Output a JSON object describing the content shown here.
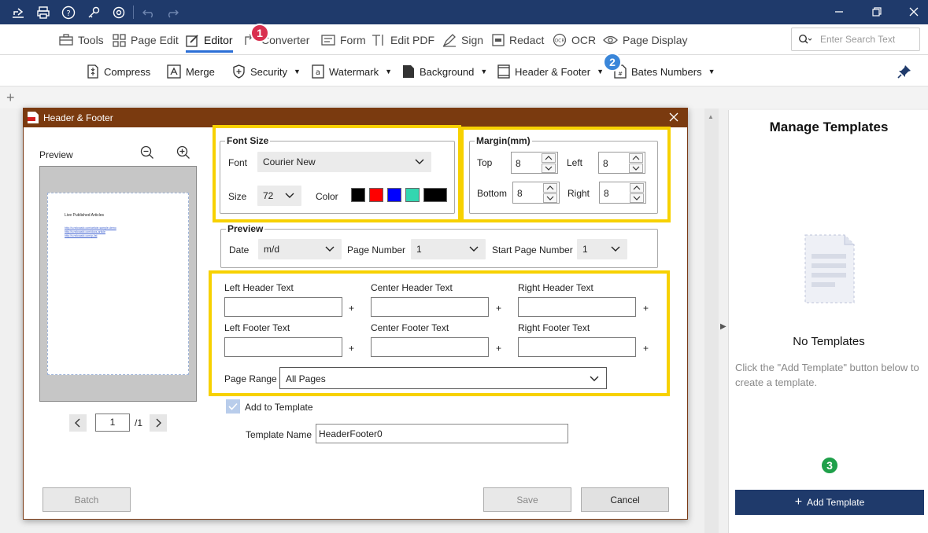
{
  "main_nav": [
    {
      "label": "Tools"
    },
    {
      "label": "Page Edit"
    },
    {
      "label": "Editor"
    },
    {
      "label": "Converter"
    },
    {
      "label": "Form"
    },
    {
      "label": "Edit PDF"
    },
    {
      "label": "Sign"
    },
    {
      "label": "Redact"
    },
    {
      "label": "OCR"
    },
    {
      "label": "Page Display"
    }
  ],
  "search": {
    "placeholder": "Enter Search Text"
  },
  "sub_toolbar": [
    {
      "label": "Compress"
    },
    {
      "label": "Merge"
    },
    {
      "label": "Security"
    },
    {
      "label": "Watermark"
    },
    {
      "label": "Background"
    },
    {
      "label": "Header & Footer"
    },
    {
      "label": "Bates Numbers"
    }
  ],
  "badges": {
    "b1": "1",
    "b2": "2",
    "b3": "3"
  },
  "dialog": {
    "title": "Header & Footer",
    "preview_label": "Preview",
    "thumb": {
      "heading": "Live Published Articles",
      "links": [
        "http://s.nnkxasfo.com/article-sample-demo",
        "http://s.nnkxasfo.com/docs-article",
        "http://s.nnkxasfo.com/p-list"
      ]
    },
    "page_input": "1",
    "page_total": "/1",
    "font_size": {
      "title": "Font Size",
      "font_label": "Font",
      "font_value": "Courier New",
      "size_label": "Size",
      "size_value": "72",
      "color_label": "Color",
      "colors": [
        "#000000",
        "#ff0000",
        "#0000ff",
        "#33d6b0",
        "#000000"
      ]
    },
    "margin": {
      "title": "Margin(mm)",
      "top_label": "Top",
      "top_value": "8",
      "left_label": "Left",
      "left_value": "8",
      "bottom_label": "Bottom",
      "bottom_value": "8",
      "right_label": "Right",
      "right_value": "8"
    },
    "preview_group": {
      "title": "Preview",
      "date_label": "Date",
      "date_value": "m/d",
      "page_number_label": "Page Number",
      "page_number_value": "1",
      "start_page_label": "Start Page Number",
      "start_page_value": "1"
    },
    "texts": {
      "left_header": "Left Header Text",
      "center_header": "Center Header Text",
      "right_header": "Right Header Text",
      "left_footer": "Left Footer Text",
      "center_footer": "Center Footer Text",
      "right_footer": "Right Footer Text",
      "plus": "+"
    },
    "page_range_label": "Page Range",
    "page_range_value": "All Pages",
    "add_to_template": "Add to Template",
    "template_name_label": "Template Name",
    "template_name_value": "HeaderFooter0",
    "batch": "Batch",
    "save": "Save",
    "cancel": "Cancel"
  },
  "templates_panel": {
    "title": "Manage Templates",
    "empty_title": "No Templates",
    "empty_hint": "Click the \"Add Template\" button below to create a template.",
    "add_button": "Add Template"
  },
  "colors": {
    "titlebar": "#1f3a6b",
    "dialog_title": "#7a3a0f",
    "highlight": "#f7d100",
    "add_button": "#1f3a6b"
  }
}
